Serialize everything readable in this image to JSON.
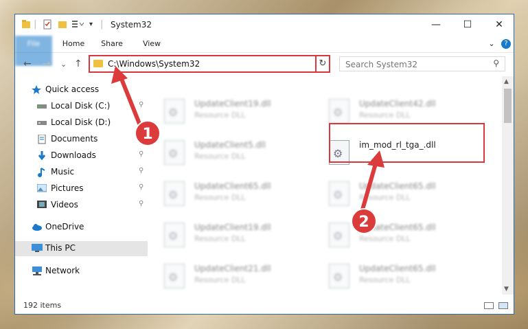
{
  "window": {
    "title": "System32",
    "controls": {
      "minimize": "—",
      "maximize": "☐",
      "close": "✕"
    }
  },
  "ribbon": {
    "tabs": [
      {
        "label": "File"
      },
      {
        "label": "Home"
      },
      {
        "label": "Share"
      },
      {
        "label": "View"
      }
    ],
    "expand": "⌄",
    "help": "?"
  },
  "nav": {
    "back": "←",
    "forward": "→",
    "recent": "⌄",
    "up": "↑",
    "address": "C:\\Windows\\System32",
    "address_dropdown": "⌄",
    "refresh": "↻",
    "search_placeholder": "Search System32",
    "search_icon": "⚲"
  },
  "sidebar": {
    "items": [
      {
        "label": "Quick access",
        "icon": "star-icon",
        "pin": ""
      },
      {
        "label": "Local Disk (C:)",
        "icon": "drive-icon",
        "pin": "📌"
      },
      {
        "label": "Local Disk (D:)",
        "icon": "drive-icon",
        "pin": ""
      },
      {
        "label": "Documents",
        "icon": "documents-icon",
        "pin": "📌"
      },
      {
        "label": "Downloads",
        "icon": "download-icon",
        "pin": "📌"
      },
      {
        "label": "Music",
        "icon": "music-icon",
        "pin": "📌"
      },
      {
        "label": "Pictures",
        "icon": "pictures-icon",
        "pin": "📌"
      },
      {
        "label": "Videos",
        "icon": "videos-icon",
        "pin": "📌"
      },
      {
        "label": "OneDrive",
        "icon": "cloud-icon",
        "pin": ""
      },
      {
        "label": "This PC",
        "icon": "computer-icon",
        "pin": ""
      },
      {
        "label": "Network",
        "icon": "network-icon",
        "pin": ""
      }
    ]
  },
  "files": [
    {
      "name": "UpdateClient19.dll",
      "type": "Resource DLL"
    },
    {
      "name": "UpdateClient42.dll",
      "type": "Resource DLL"
    },
    {
      "name": "UpdateClient5.dll",
      "type": "Resource DLL"
    },
    {
      "name": "im_mod_rl_tga_.dll",
      "type": ""
    },
    {
      "name": "UpdateClient65.dll",
      "type": "Resource DLL"
    },
    {
      "name": "UpdateClient65.dll",
      "type": "Resource DLL"
    },
    {
      "name": "UpdateClient19.dll",
      "type": "Resource DLL"
    },
    {
      "name": "UpdateClient65.dll",
      "type": "Resource DLL"
    },
    {
      "name": "UpdateClient21.dll",
      "type": "Resource DLL"
    },
    {
      "name": "UpdateClient65.dll",
      "type": "Resource DLL"
    }
  ],
  "status": {
    "count": "192 items"
  },
  "annotations": {
    "step1": "1",
    "step2": "2"
  },
  "colors": {
    "accent": "#1979ca",
    "highlight": "#d9363e"
  }
}
